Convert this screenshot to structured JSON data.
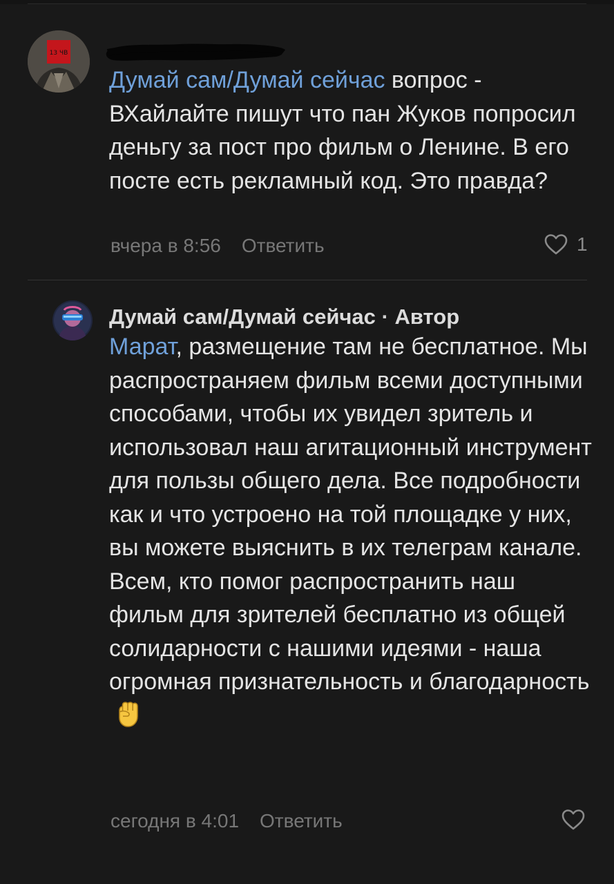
{
  "comments": [
    {
      "mention": "Думай сам/Думай сейчас",
      "text": " вопрос - ВХайлайте пишут что пан Жуков попросил деньгу за пост про фильм о Ленине. В его посте есть рекламный код. Это правда?",
      "time": "вчера в 8:56",
      "reply_label": "Ответить",
      "likes": "1",
      "avatar_badge": "13 ЧВ"
    },
    {
      "author": "Думай сам/Думай сейчас",
      "author_separator": " · ",
      "author_role": "Автор",
      "mention": "Марат",
      "text": ", размещение там не бесплатное. Мы распространяем фильм всеми доступными способами, чтобы их увидел зритель и использовал наш агитационный инструмент для пользы общего дела. Все подробности как и что устроено на той площадке у них, вы можете выяснить в их телеграм канале. Всем, кто помог распространить наш фильм для зрителей бесплатно из общей солидарности с нашими идеями - наша огромная признательность и благодарность",
      "time": "сегодня в 4:01",
      "reply_label": "Ответить"
    }
  ],
  "colors": {
    "background": "#191919",
    "text": "#e4e4e4",
    "mention": "#6fa0d9",
    "meta": "#777777"
  }
}
